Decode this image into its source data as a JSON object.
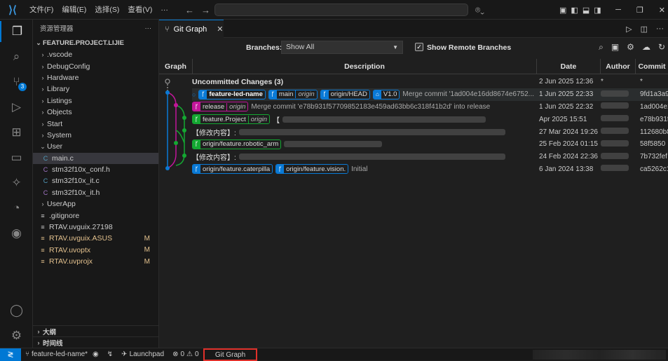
{
  "titlebar": {
    "menus": [
      "文件(F)",
      "编辑(E)",
      "选择(S)",
      "查看(V)",
      "···"
    ]
  },
  "sidebar": {
    "title": "资源管理器",
    "more": "···",
    "root": "FEATURE.PROJECT.LIJIE",
    "items": [
      {
        "label": ".vscode",
        "kind": "folder"
      },
      {
        "label": "DebugConfig",
        "kind": "folder"
      },
      {
        "label": "Hardware",
        "kind": "folder"
      },
      {
        "label": "Library",
        "kind": "folder"
      },
      {
        "label": "Listings",
        "kind": "folder"
      },
      {
        "label": "Objects",
        "kind": "folder"
      },
      {
        "label": "Start",
        "kind": "folder"
      },
      {
        "label": "System",
        "kind": "folder"
      },
      {
        "label": "User",
        "kind": "folder-open"
      },
      {
        "label": "main.c",
        "kind": "c"
      },
      {
        "label": "stm32f10x_conf.h",
        "kind": "h"
      },
      {
        "label": "stm32f10x_it.c",
        "kind": "c"
      },
      {
        "label": "stm32f10x_it.h",
        "kind": "h"
      },
      {
        "label": "UserApp",
        "kind": "folder"
      },
      {
        "label": ".gitignore",
        "kind": "file"
      },
      {
        "label": "RTAV.uvguix.27198",
        "kind": "file"
      },
      {
        "label": "RTAV.uvguix.ASUS",
        "kind": "file",
        "flag": "M"
      },
      {
        "label": "RTAV.uvoptx",
        "kind": "file",
        "flag": "M"
      },
      {
        "label": "RTAV.uvprojx",
        "kind": "file",
        "flag": "M"
      }
    ],
    "outline": "大纲",
    "timeline": "时间线"
  },
  "activity": {
    "scm_badge": "3"
  },
  "tab": {
    "label": "Git Graph",
    "close": "✕"
  },
  "controls": {
    "branches_label": "Branches:",
    "branches_value": "Show All",
    "show_remote_label": "Show Remote Branches",
    "show_remote_checked": true
  },
  "columns": {
    "graph": "Graph",
    "description": "Description",
    "date": "Date",
    "author": "Author",
    "commit": "Commit"
  },
  "commits": [
    {
      "title": "Uncommitted Changes (3)",
      "refs": [],
      "message": "",
      "date": "2 Jun 2025 12:36",
      "author": "*",
      "hash": "*"
    },
    {
      "refs": [
        {
          "name": "feature-led-name",
          "color": "#0a7ad6",
          "bold": true
        },
        {
          "name": "main",
          "remote": "origin",
          "color": "#0a7ad6"
        },
        {
          "name": "origin/HEAD",
          "color": "#0a7ad6"
        },
        {
          "name": "V1.0",
          "color": "#0a7ad6",
          "tag": true
        }
      ],
      "message": "Merge commit '1ad004e16dd8674e6752...",
      "date": "1 Jun 2025 22:33",
      "author": "",
      "hash": "9fd1a3a9"
    },
    {
      "refs": [
        {
          "name": "release",
          "remote": "origin",
          "color": "#c2169a"
        }
      ],
      "message": "Merge commit 'e78b931f57709852183e459ad63bb6c318f41b2d' into release",
      "date": "1 Jun 2025 22:32",
      "author": "",
      "hash": "1ad004e1"
    },
    {
      "refs": [
        {
          "name": "feature.Project",
          "remote": "origin",
          "color": "#14a832"
        }
      ],
      "message": "【",
      "date": "Apr 2025 15:51",
      "author": "",
      "hash": "e78b931f"
    },
    {
      "refs": [],
      "message": "【修改内容】:",
      "date": "27 Mar 2024 19:26",
      "author": "",
      "hash": "112680b8"
    },
    {
      "refs": [
        {
          "name": "origin/feature.robotic_arm",
          "color": "#14a832"
        }
      ],
      "message": "",
      "date": "25 Feb 2024 01:15",
      "author": "",
      "hash": "58f5850"
    },
    {
      "refs": [],
      "message": "【修改内容】:",
      "date": "24 Feb 2024 22:36",
      "author": "",
      "hash": "7b732fef"
    },
    {
      "refs": [
        {
          "name": "origin/feature.caterpilla",
          "color": "#0a7ad6"
        },
        {
          "name": "origin/feature.vision.",
          "color": "#0a7ad6"
        }
      ],
      "message": "Initial",
      "date": "6 Jan 2024 13:38",
      "author": "",
      "hash": "ca5262c1"
    }
  ],
  "statusbar": {
    "branch": "feature-led-name*",
    "launchpad": "Launchpad",
    "errors": "0",
    "warnings": "0",
    "gitgraph": "Git Graph"
  }
}
